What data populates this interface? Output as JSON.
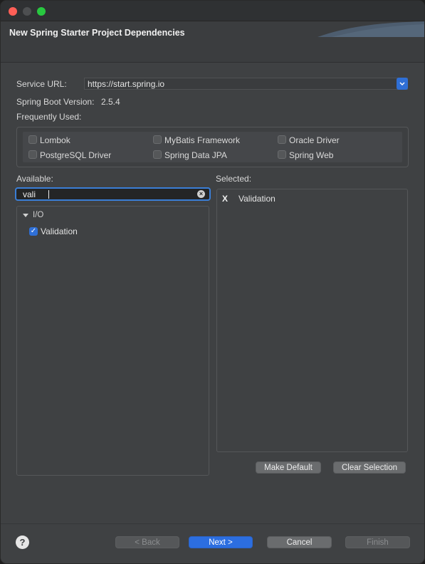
{
  "window": {
    "title": "New Spring Starter Project Dependencies"
  },
  "service": {
    "url_label": "Service URL:",
    "url_value": "https://start.spring.io"
  },
  "boot": {
    "label": "Spring Boot Version:",
    "value": "2.5.4"
  },
  "frequent": {
    "label": "Frequently Used:",
    "items": [
      {
        "label": "Lombok",
        "checked": false
      },
      {
        "label": "MyBatis Framework",
        "checked": false
      },
      {
        "label": "Oracle Driver",
        "checked": false
      },
      {
        "label": "PostgreSQL Driver",
        "checked": false
      },
      {
        "label": "Spring Data JPA",
        "checked": false
      },
      {
        "label": "Spring Web",
        "checked": false
      }
    ]
  },
  "available": {
    "label": "Available:",
    "search_value": "vali",
    "category": "I/O",
    "item": "Validation",
    "item_checked": true
  },
  "selected": {
    "label": "Selected:",
    "remove_glyph": "X",
    "item": "Validation"
  },
  "buttons": {
    "make_default": "Make Default",
    "clear_selection": "Clear Selection",
    "back": "< Back",
    "next": "Next >",
    "cancel": "Cancel",
    "finish": "Finish",
    "help": "?"
  },
  "colors": {
    "accent": "#2c6ee0",
    "window_bg": "#3f4143",
    "close": "#ff5f57",
    "maximize": "#28c840"
  }
}
